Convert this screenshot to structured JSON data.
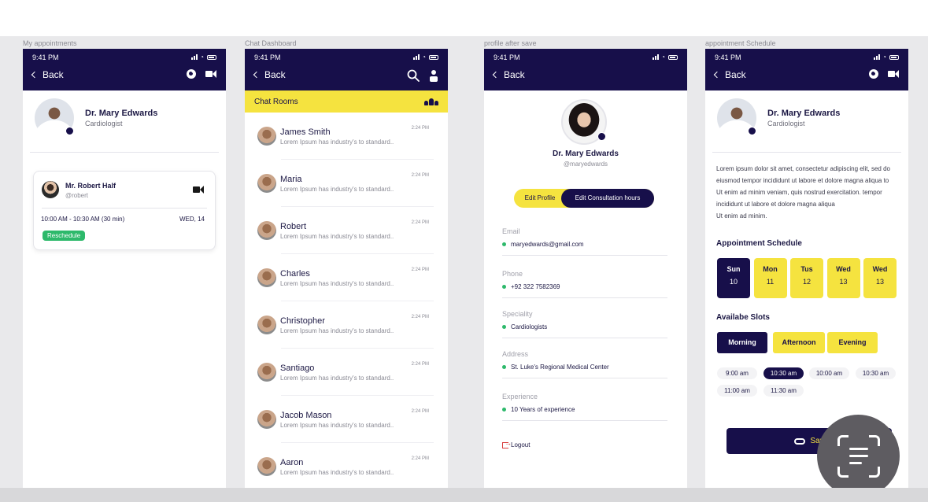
{
  "frame_labels": [
    "My appointments",
    "Chat Dashboard",
    "profile after save",
    "appointment Schedule"
  ],
  "status_time": "9:41 PM",
  "back_label": "Back",
  "appointments": {
    "doctor_name": "Dr. Mary Edwards",
    "doctor_specialty": "Cardiologist",
    "card": {
      "patient_name": "Mr. Robert Half",
      "patient_handle": "@robert",
      "time_range": "10:00 AM - 10:30 AM (30 min)",
      "date": "WED, 14",
      "reschedule_label": "Reschedule"
    }
  },
  "chat": {
    "title": "Chat Rooms",
    "rooms": [
      {
        "name": "James Smith",
        "message": "Lorem Ipsum has industry's to standard..",
        "time": "2:24 PM"
      },
      {
        "name": "Maria",
        "message": "Lorem Ipsum has industry's to standard..",
        "time": "2:24 PM"
      },
      {
        "name": "Robert",
        "message": "Lorem Ipsum has industry's to standard..",
        "time": "2:24 PM"
      },
      {
        "name": "Charles",
        "message": "Lorem Ipsum has industry's to standard..",
        "time": "2:24 PM"
      },
      {
        "name": "Christopher",
        "message": "Lorem Ipsum has industry's to standard..",
        "time": "2:24 PM"
      },
      {
        "name": "Santiago",
        "message": "Lorem Ipsum has industry's to standard..",
        "time": "2:24 PM"
      },
      {
        "name": "Jacob Mason",
        "message": "Lorem Ipsum has industry's to standard..",
        "time": "2:24 PM"
      },
      {
        "name": "Aaron",
        "message": "Lorem Ipsum has industry's to standard..",
        "time": "2:24 PM"
      }
    ]
  },
  "profile": {
    "name": "Dr. Mary Edwards",
    "handle": "@maryedwards",
    "edit_profile_label": "Edit Profile",
    "edit_hours_label": "Edit Consultation hours",
    "fields": [
      {
        "label": "Email",
        "value": "maryedwards@gmail.com"
      },
      {
        "label": "Phone",
        "value": "+92 322 7582369"
      },
      {
        "label": "Speciality",
        "value": "Cardiologists"
      },
      {
        "label": "Address",
        "value": "St. Luke's Regional Medical Center"
      },
      {
        "label": "Experience",
        "value": "10 Years of experience"
      }
    ],
    "logout_label": "Logout"
  },
  "schedule": {
    "doctor_name": "Dr. Mary Edwards",
    "doctor_specialty": "Cardiologist",
    "description_lines": [
      "Lorem ipsum dolor sit amet, consectetur adipiscing elit, sed do",
      "eiusmod tempor incididunt ut labore et dolore magna aliqua to",
      "Ut enim ad minim veniam, quis nostrud exercitation.  tempor",
      "incididunt ut labore et dolore magna aliqua",
      "Ut enim ad minim."
    ],
    "schedule_title": "Appointment Schedule",
    "days": [
      {
        "day": "Sun",
        "date": "10",
        "selected": true
      },
      {
        "day": "Mon",
        "date": "11",
        "selected": false
      },
      {
        "day": "Tus",
        "date": "12",
        "selected": false
      },
      {
        "day": "Wed",
        "date": "13",
        "selected": false
      },
      {
        "day": "Wed",
        "date": "13",
        "selected": false
      }
    ],
    "slots_title": "Availabe Slots",
    "periods": [
      {
        "label": "Morning",
        "selected": true
      },
      {
        "label": "Afternoon",
        "selected": false
      },
      {
        "label": "Evening",
        "selected": false
      }
    ],
    "times": [
      {
        "label": "9:00 am",
        "selected": false
      },
      {
        "label": "10:30 am",
        "selected": true
      },
      {
        "label": "10:00 am",
        "selected": false
      },
      {
        "label": "10:30 am",
        "selected": false
      },
      {
        "label": "11:00 am",
        "selected": false
      },
      {
        "label": "11:30 am",
        "selected": false
      }
    ],
    "save_label": "Sav"
  },
  "icons": [
    "chevron-left-icon",
    "phone-icon",
    "video-icon",
    "search-icon",
    "user-icon",
    "group-icon",
    "camera-icon",
    "logout-icon",
    "link-icon",
    "scan-text-icon"
  ],
  "colors": {
    "primary": "#170f4a",
    "accent": "#f5e33f",
    "success": "#2db96b"
  }
}
